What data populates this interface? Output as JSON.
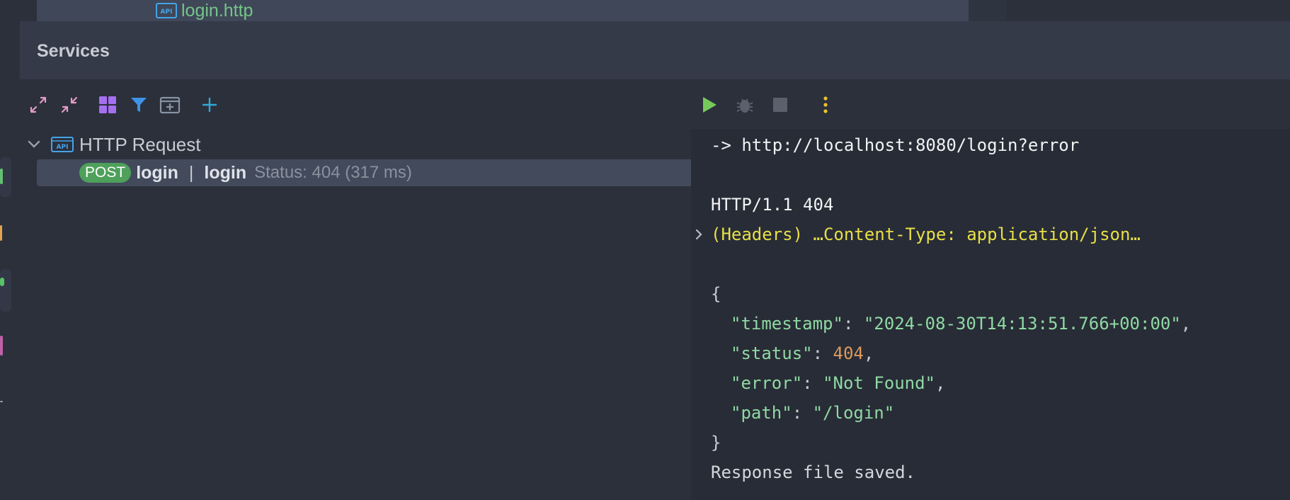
{
  "project_tree": {
    "file_icon": "api-file-icon",
    "file_name": "login.http"
  },
  "services": {
    "title": "Services"
  },
  "left_toolbar": {
    "buttons": [
      {
        "icon": "expand-all-icon",
        "color": "#e59ac8"
      },
      {
        "icon": "collapse-all-icon",
        "color": "#e59ac8"
      },
      {
        "icon": "group-by-icon",
        "color": "#a66ff0"
      },
      {
        "icon": "filter-icon",
        "color": "#3f93e8"
      },
      {
        "icon": "new-tab-icon",
        "color": "#8893a3"
      },
      {
        "icon": "add-icon",
        "color": "#31a8d8"
      }
    ]
  },
  "tree": {
    "group_label": "HTTP Request",
    "group_icon": "api-file-icon",
    "request": {
      "method": "POST",
      "name": "login",
      "separator": "|",
      "file": "login",
      "status": "Status: 404 (317 ms)"
    }
  },
  "right_toolbar": {
    "buttons": [
      {
        "icon": "run-icon",
        "color": "#78c95c"
      },
      {
        "icon": "debug-icon",
        "color": "#5a606c"
      },
      {
        "icon": "stop-icon",
        "color": "#5a606c"
      },
      {
        "icon": "more-icon",
        "color": "#e8c42a"
      }
    ]
  },
  "output": {
    "request_line": "-> http://localhost:8080/login?error",
    "status_line": "HTTP/1.1 404",
    "headers_line": "(Headers) …Content-Type: application/json…",
    "open_brace": "{",
    "fields": [
      {
        "key": "\"timestamp\"",
        "value": "\"2024-08-30T14:13:51.766+00:00\"",
        "type": "string",
        "trail": ","
      },
      {
        "key": "\"status\"",
        "value": "404",
        "type": "number",
        "trail": ","
      },
      {
        "key": "\"error\"",
        "value": "\"Not Found\"",
        "type": "string",
        "trail": ","
      },
      {
        "key": "\"path\"",
        "value": "\"/login\"",
        "type": "string",
        "trail": ""
      }
    ],
    "close_brace": "}",
    "saved_line": "Response file saved."
  }
}
